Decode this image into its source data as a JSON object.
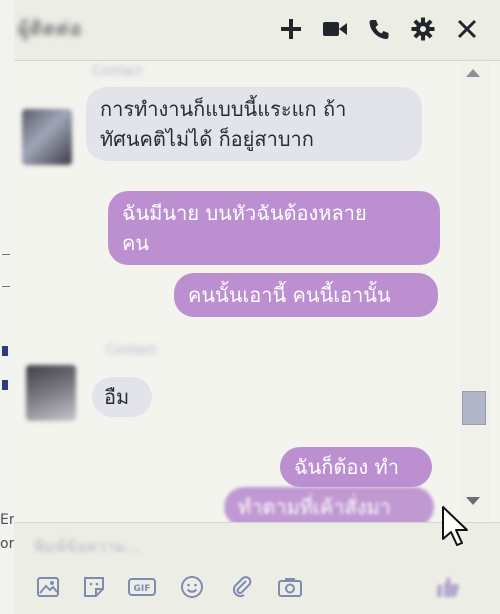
{
  "header": {
    "contact_name": "ผู้ติดต่อ",
    "icons": [
      "plus-icon",
      "video-camera-icon",
      "phone-icon",
      "gear-icon",
      "close-icon"
    ]
  },
  "page_strip": {
    "texts": [
      "En",
      "or"
    ]
  },
  "messages": [
    {
      "sender": "Contact",
      "text_lines": [
        "การทำงานก็แบบนี้แระแก ถ้า",
        "ทัศนคติไม่ได้ ก็อยู่สาบาก"
      ],
      "direction": "in"
    },
    {
      "text_lines": [
        "ฉันมีนาย บนหัวฉันต้องหลาย",
        "คน"
      ],
      "direction": "out"
    },
    {
      "text_lines": [
        "คนนั้นเอานี้ คนนี้เอานั้น"
      ],
      "direction": "out"
    },
    {
      "sender": "Contact",
      "text_lines": [
        "อืม"
      ],
      "direction": "in"
    },
    {
      "text_lines": [
        "ฉันก็ต้อง ทำ"
      ],
      "direction": "out"
    },
    {
      "text_lines": [
        "ทำตามที่เค้าสั่งมา"
      ],
      "direction": "out"
    }
  ],
  "composer": {
    "placeholder": "พิมพ์ข้อความ...",
    "icons": [
      "image-icon",
      "sticker-icon",
      "gif-icon",
      "emoji-icon",
      "attachment-icon",
      "camera-icon",
      "like-icon"
    ]
  },
  "colors": {
    "outgoing_bubble": "#bb8fd0",
    "incoming_bubble": "#e2e3eb",
    "header_bg": "#eceee6"
  }
}
